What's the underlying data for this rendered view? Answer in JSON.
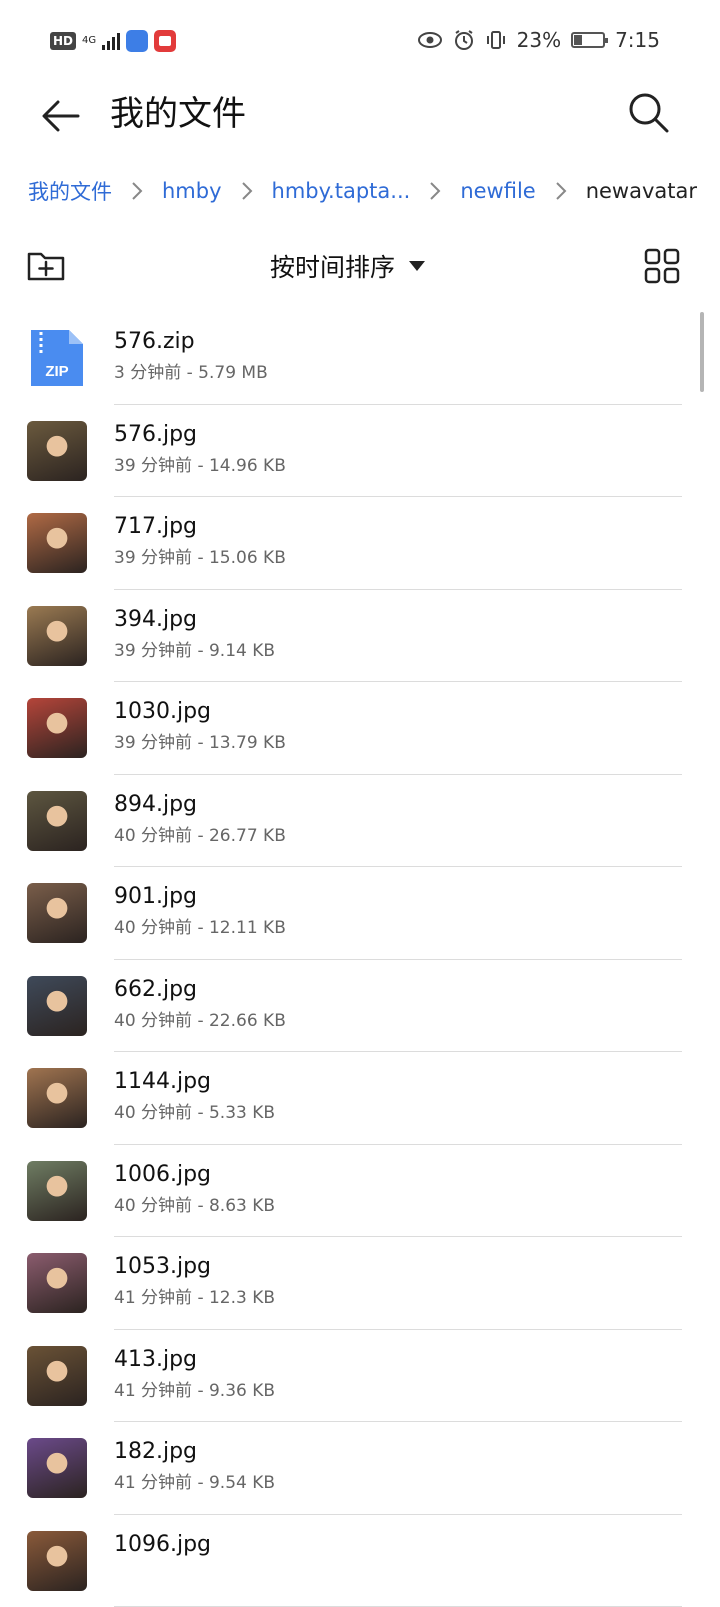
{
  "status_bar": {
    "left_labels": {
      "hd": "HD",
      "network": "4G"
    },
    "battery_percent": "23%",
    "time": "7:15",
    "icons": [
      "hd-icon",
      "signal-icon",
      "app-blue-icon",
      "app-red-icon",
      "eye-icon",
      "alarm-icon",
      "vibrate-icon",
      "battery-icon"
    ]
  },
  "header": {
    "title": "我的文件",
    "back_icon": "arrow-left-icon",
    "search_icon": "search-icon"
  },
  "breadcrumb": [
    {
      "label": "我的文件"
    },
    {
      "label": "hmby"
    },
    {
      "label": "hmby.tapta..."
    },
    {
      "label": "newfile"
    },
    {
      "label": "newavatar"
    }
  ],
  "toolbar": {
    "new_folder_icon": "new-folder-icon",
    "sort_label": "按时间排序",
    "grid_icon": "grid-view-icon"
  },
  "files": [
    {
      "name": "576.zip",
      "meta": "3 分钟前 - 5.79 MB",
      "type": "zip",
      "color": "#4a8cf0"
    },
    {
      "name": "576.jpg",
      "meta": "39 分钟前 - 14.96 KB",
      "type": "image",
      "color": "#6b5a3e"
    },
    {
      "name": "717.jpg",
      "meta": "39 分钟前 - 15.06 KB",
      "type": "image",
      "color": "#b06a45"
    },
    {
      "name": "394.jpg",
      "meta": "39 分钟前 - 9.14 KB",
      "type": "image",
      "color": "#9a7a52"
    },
    {
      "name": "1030.jpg",
      "meta": "39 分钟前 - 13.79 KB",
      "type": "image",
      "color": "#b5453a"
    },
    {
      "name": "894.jpg",
      "meta": "40 分钟前 - 26.77 KB",
      "type": "image",
      "color": "#5d5640"
    },
    {
      "name": "901.jpg",
      "meta": "40 分钟前 - 12.11 KB",
      "type": "image",
      "color": "#7a5e4a"
    },
    {
      "name": "662.jpg",
      "meta": "40 分钟前 - 22.66 KB",
      "type": "image",
      "color": "#3f4a5a"
    },
    {
      "name": "1144.jpg",
      "meta": "40 分钟前 - 5.33 KB",
      "type": "image",
      "color": "#a07450"
    },
    {
      "name": "1006.jpg",
      "meta": "40 分钟前 - 8.63 KB",
      "type": "image",
      "color": "#6f7d63"
    },
    {
      "name": "1053.jpg",
      "meta": "41 分钟前 - 12.3 KB",
      "type": "image",
      "color": "#8b5c6e"
    },
    {
      "name": "413.jpg",
      "meta": "41 分钟前 - 9.36 KB",
      "type": "image",
      "color": "#6a5236"
    },
    {
      "name": "182.jpg",
      "meta": "41 分钟前 - 9.54 KB",
      "type": "image",
      "color": "#6b4a8a"
    },
    {
      "name": "1096.jpg",
      "meta": "",
      "type": "image",
      "color": "#8a5a3a"
    }
  ],
  "colors": {
    "accent": "#2f6bd6",
    "divider": "#dcdcdc",
    "zip_icon": "#4a8cf0"
  }
}
